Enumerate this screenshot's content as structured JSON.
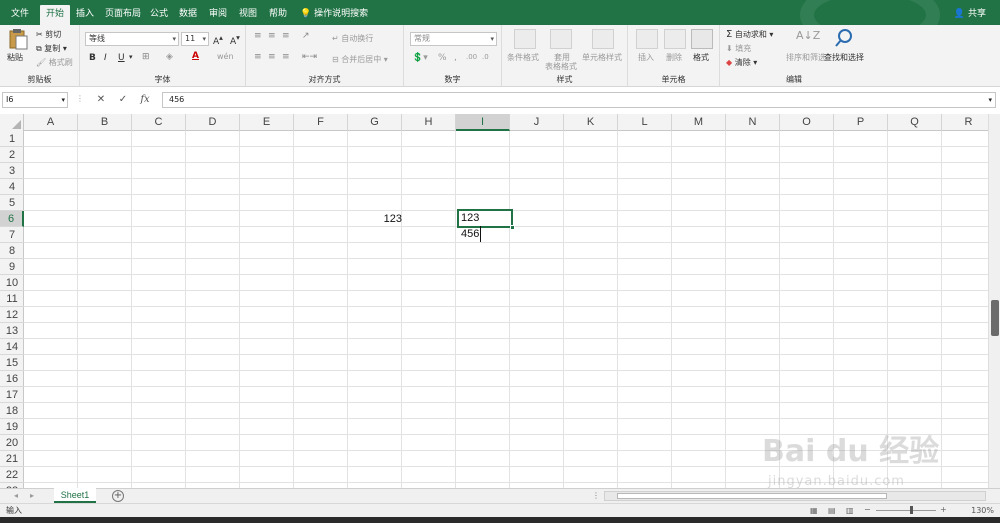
{
  "tabs": {
    "items": [
      "文件",
      "开始",
      "插入",
      "页面布局",
      "公式",
      "数据",
      "审阅",
      "视图",
      "帮助"
    ],
    "active_index": 1
  },
  "tell_me": "操作说明搜索",
  "share": "共享",
  "ribbon": {
    "clipboard": {
      "paste": "粘贴",
      "cut": "剪切",
      "copy": "复制",
      "format_painter": "格式刷",
      "label": "剪贴板"
    },
    "font": {
      "name": "等线",
      "size": "11",
      "bold": "B",
      "italic": "I",
      "underline": "U",
      "label": "字体"
    },
    "alignment": {
      "wrap": "自动换行",
      "merge": "合并后居中",
      "label": "对齐方式"
    },
    "number": {
      "format": "常规",
      "label": "数字"
    },
    "styles": {
      "conditional": "条件格式",
      "table_line1": "套用",
      "table_line2": "表格格式",
      "cell_styles": "单元格样式",
      "label": "样式"
    },
    "cells": {
      "insert": "插入",
      "delete": "删除",
      "format": "格式",
      "label": "单元格"
    },
    "editing": {
      "autosum": "自动求和",
      "fill": "填充",
      "clear": "清除",
      "sort": "排序和筛选",
      "find": "查找和选择",
      "label": "编辑"
    }
  },
  "formula_bar": {
    "name_box": "I6",
    "value": "456"
  },
  "columns": [
    "A",
    "B",
    "C",
    "D",
    "E",
    "F",
    "G",
    "H",
    "I",
    "J",
    "K",
    "L",
    "M",
    "N",
    "O",
    "P",
    "Q",
    "R"
  ],
  "rows": [
    "1",
    "2",
    "3",
    "4",
    "5",
    "6",
    "7",
    "8",
    "9",
    "10",
    "11",
    "12",
    "13",
    "14",
    "15",
    "16",
    "17",
    "18",
    "19",
    "20",
    "21",
    "22",
    "23"
  ],
  "selected_column": "I",
  "selected_row": "6",
  "cells": {
    "G6": "123",
    "I6_line1": "123",
    "I6_line2": "456"
  },
  "sheet_tab": "Sheet1",
  "status": {
    "mode": "输入",
    "zoom": "130%"
  },
  "watermark": {
    "brand": "Bai du 经验",
    "url": "jingyan.baidu.com"
  },
  "colors": {
    "accent": "#217346"
  }
}
